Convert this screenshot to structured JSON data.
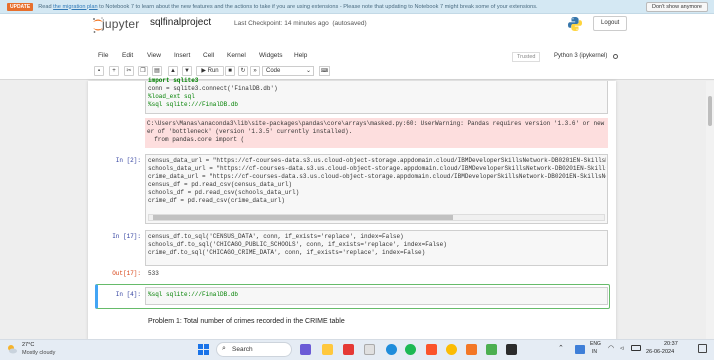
{
  "banner": {
    "tag": "UPDATE",
    "msg_prefix": "Read ",
    "msg_link": "the migration plan",
    "msg_suffix": " to Notebook 7 to learn about the new features and the actions to take if you are using extensions - Please note that updating to Notebook 7 might break some of your extensions.",
    "dont_show": "Don't show anymore"
  },
  "header": {
    "logo_text": "jupyter",
    "notebook_name": "sqlfinalproject",
    "checkpoint_label": "Last Checkpoint: ",
    "checkpoint_time": "14 minutes ago",
    "autosaved": "(autosaved)",
    "logout": "Logout"
  },
  "menu": {
    "items": [
      "File",
      "Edit",
      "View",
      "Insert",
      "Cell",
      "Kernel",
      "Widgets",
      "Help"
    ],
    "trusted": "Trusted",
    "kernel": "Python 3 (ipykernel)"
  },
  "toolbar": {
    "run_label": "Run",
    "cell_type": "Code"
  },
  "cells": {
    "c1_lines": [
      "import sqlite3",
      "conn = sqlite3.connect('FinalDB.db')",
      "%load_ext sql",
      "%sql sqlite:///FinalDB.db"
    ],
    "c1_stderr": [
      "C:\\Users\\Manas\\anaconda3\\lib\\site-packages\\pandas\\core\\arrays\\masked.py:60: UserWarning: Pandas requires version '1.3.6' or new",
      "er of 'bottleneck' (version '1.3.5' currently installed).",
      "  from pandas.core import ("
    ],
    "c2_prompt": "In [2]:",
    "c2_lines": [
      "census_data_url = \"https://cf-courses-data.s3.us.cloud-object-storage.appdomain.cloud/IBMDeveloperSkillsNetwork-DB0201EN-SkillsNe",
      "schools_data_url = \"https://cf-courses-data.s3.us.cloud-object-storage.appdomain.cloud/IBMDeveloperSkillsNetwork-DB0201EN-SkillsN",
      "crime_data_url = \"https://cf-courses-data.s3.us.cloud-object-storage.appdomain.cloud/IBMDeveloperSkillsNetwork-DB0201EN-SkillsNe",
      "census_df = pd.read_csv(census_data_url)",
      "schools_df = pd.read_csv(schools_data_url)",
      "crime_df = pd.read_csv(crime_data_url)"
    ],
    "c3_prompt": "In [17]:",
    "c3_lines": [
      "census_df.to_sql('CENSUS_DATA', conn, if_exists='replace', index=False)",
      "schools_df.to_sql('CHICAGO_PUBLIC_SCHOOLS', conn, if_exists='replace', index=False)",
      "crime_df.to_sql('CHICAGO_CRIME_DATA', conn, if_exists='replace', index=False)"
    ],
    "c3_out_prompt": "Out[17]:",
    "c3_out": "533",
    "c4_prompt": "In [4]:",
    "c4_line": "%sql sqlite:///FinalDB.db",
    "md_text": "Problem 1: Total number of crimes recorded in the CRIME table"
  },
  "taskbar": {
    "weather_temp": "27°C",
    "weather_desc": "Mostly cloudy",
    "search": "Search",
    "lang1": "ENG",
    "lang2": "IN",
    "time": "20:37",
    "date": "26-06-2024"
  }
}
